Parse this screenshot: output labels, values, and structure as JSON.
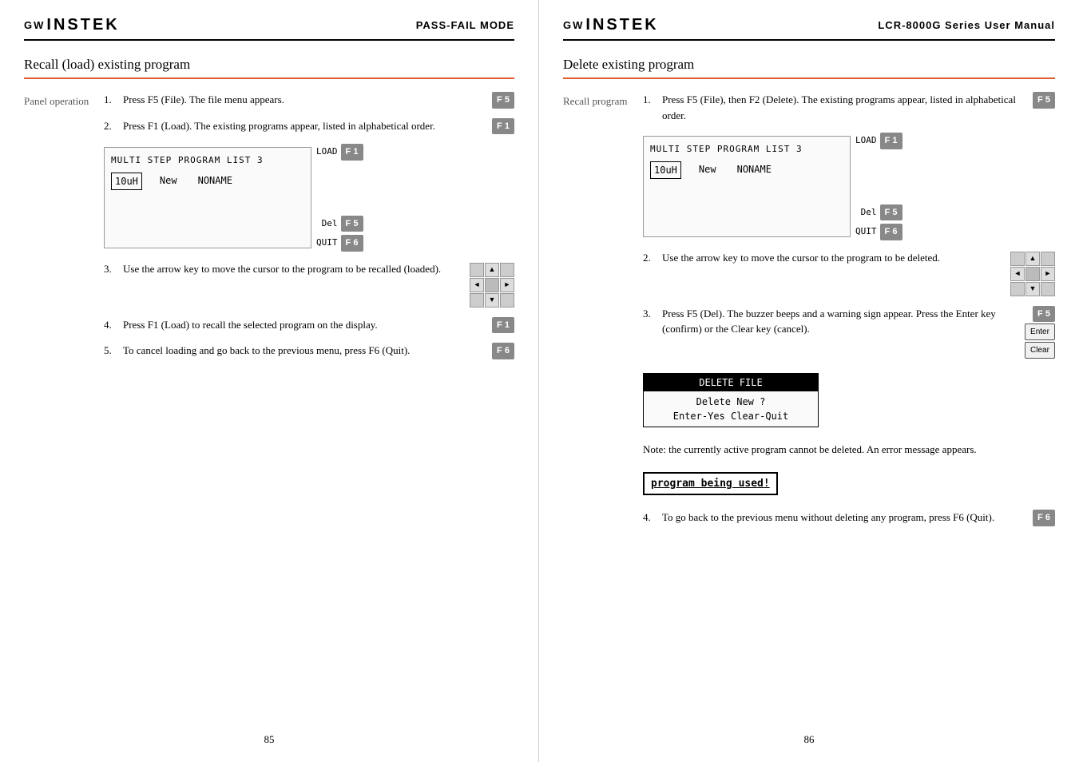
{
  "left_page": {
    "logo": "GW INSTEK",
    "logo_gw": "GW",
    "logo_instek": "INSTEK",
    "header_title": "PASS-FAIL MODE",
    "section_title": "Recall (load) existing program",
    "step_label": "Panel operation",
    "steps": [
      {
        "num": "1.",
        "text": "Press F5 (File). The file menu appears.",
        "fkey": "F 5",
        "fkey_style": "filled"
      },
      {
        "num": "2.",
        "text": "Press F1 (Load). The existing programs appear, listed in alphabetical order.",
        "fkey": "F 1",
        "fkey_style": "filled"
      },
      {
        "num": "3.",
        "text": "Use the arrow key to move the cursor to the program to be recalled (loaded).",
        "icon": "arrows"
      },
      {
        "num": "4.",
        "text": "Press F1 (Load) to recall the selected program on the display.",
        "fkey": "F 1",
        "fkey_style": "filled"
      },
      {
        "num": "5.",
        "text": "To cancel loading and go back to the previous menu, press F6 (Quit).",
        "fkey": "F 6",
        "fkey_style": "filled"
      }
    ],
    "program_list": {
      "title": "MULTI STEP PROGRAM LIST 3",
      "load_label": "LOAD",
      "items": [
        "10uH",
        "New",
        "NONAME"
      ],
      "del_label": "Del",
      "quit_label": "QUIT",
      "del_fkey": "F 5",
      "quit_fkey": "F 6"
    },
    "page_number": "85"
  },
  "right_page": {
    "logo": "GW INSTEK",
    "logo_gw": "GW",
    "logo_instek": "INSTEK",
    "header_title": "LCR-8000G Series User Manual",
    "section_title": "Delete existing program",
    "recall_label": "Recall program",
    "steps": [
      {
        "num": "1.",
        "text": "Press F5 (File), then F2 (Delete). The existing programs appear, listed in alphabetical order.",
        "fkey": "F 5",
        "fkey_style": "filled"
      },
      {
        "num": "2.",
        "text": "Use the arrow key to move the cursor to the program to be deleted.",
        "icon": "arrows"
      },
      {
        "num": "3.",
        "text": "Press F5 (Del). The buzzer beeps and a warning sign appear. Press the Enter key (confirm) or the Clear key (cancel).",
        "fkey": "F 5",
        "enter_key": "Enter",
        "clear_key": "Clear"
      },
      {
        "num": "4.",
        "text": "To go back to the previous menu without deleting any program, press F6 (Quit).",
        "fkey": "F 6",
        "fkey_style": "filled"
      }
    ],
    "program_list": {
      "title": "MULTI STEP PROGRAM LIST 3",
      "load_label": "LOAD",
      "items": [
        "10uH",
        "New",
        "NONAME"
      ],
      "del_label": "Del",
      "quit_label": "QUIT",
      "del_fkey": "F 5",
      "quit_fkey": "F 6"
    },
    "delete_box": {
      "header": "DELETE FILE",
      "line1": "Delete New ?",
      "line2": "Enter-Yes  Clear-Quit"
    },
    "note_text": "Note: the currently active program cannot be deleted. An error message appears.",
    "program_used": "program being used!",
    "page_number": "86"
  }
}
